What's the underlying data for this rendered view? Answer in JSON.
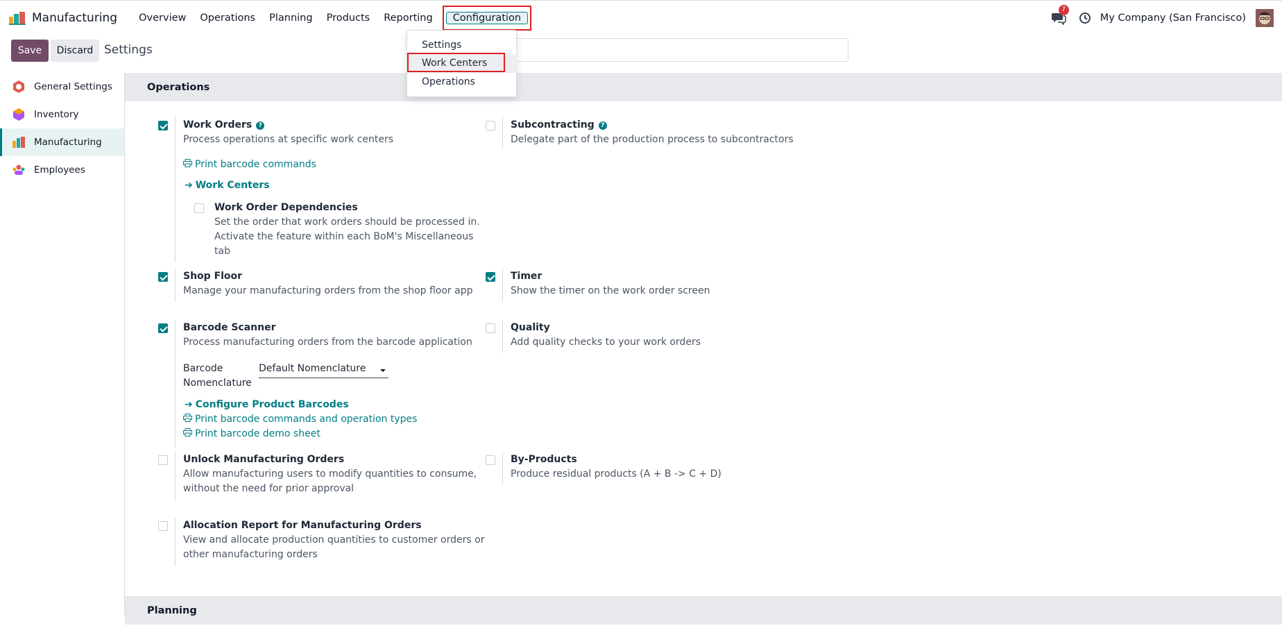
{
  "topbar": {
    "app_name": "Manufacturing",
    "nav": [
      "Overview",
      "Operations",
      "Planning",
      "Products",
      "Reporting",
      "Configuration"
    ],
    "notification_count": "7",
    "company": "My Company (San Francisco)"
  },
  "dropdown": {
    "items": [
      "Settings",
      "Work Centers",
      "Operations"
    ]
  },
  "control_panel": {
    "save": "Save",
    "discard": "Discard",
    "breadcrumb": "Settings"
  },
  "sidebar": {
    "items": [
      "General Settings",
      "Inventory",
      "Manufacturing",
      "Employees"
    ]
  },
  "sections": {
    "operations": "Operations",
    "planning": "Planning"
  },
  "settings": {
    "work_orders": {
      "title": "Work Orders",
      "desc": "Process operations at specific work centers",
      "checked": true
    },
    "print_barcode_commands": "Print barcode commands",
    "work_centers_link": "Work Centers",
    "wo_dependencies": {
      "title": "Work Order Dependencies",
      "desc": [
        "Set the order that work orders should be processed in.",
        "Activate the feature within each BoM's Miscellaneous",
        "tab"
      ],
      "checked": false
    },
    "subcontracting": {
      "title": "Subcontracting",
      "desc": "Delegate part of the production process to subcontractors",
      "checked": false
    },
    "shop_floor": {
      "title": "Shop Floor",
      "desc": "Manage your manufacturing orders from the shop floor app",
      "checked": true
    },
    "timer": {
      "title": "Timer",
      "desc": "Show the timer on the work order screen",
      "checked": true
    },
    "barcode_scanner": {
      "title": "Barcode Scanner",
      "desc": "Process manufacturing orders from the barcode application",
      "checked": true
    },
    "barcode_nomenclature_label": [
      "Barcode",
      "Nomenclature"
    ],
    "barcode_nomenclature_value": "Default Nomenclature",
    "configure_barcodes": "Configure Product Barcodes",
    "print_barcode_ops": "Print barcode commands and operation types",
    "print_demo_sheet": "Print barcode demo sheet",
    "quality": {
      "title": "Quality",
      "desc": "Add quality checks to your work orders",
      "checked": false
    },
    "unlock_mo": {
      "title": "Unlock Manufacturing Orders",
      "desc": [
        "Allow manufacturing users to modify quantities to consume,",
        "without the need for prior approval"
      ],
      "checked": false
    },
    "by_products": {
      "title": "By-Products",
      "desc": "Produce residual products (A + B -> C + D)",
      "checked": false
    },
    "allocation": {
      "title": "Allocation Report for Manufacturing Orders",
      "desc": [
        "View and allocate production quantities to customer orders or",
        "other manufacturing orders"
      ],
      "checked": false
    }
  },
  "colors": {
    "accent": "#017e84",
    "primary": "#714b67",
    "highlight": "#e02020"
  }
}
